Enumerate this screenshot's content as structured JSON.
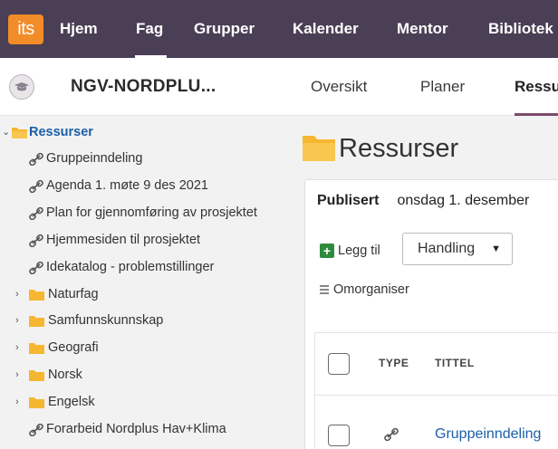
{
  "topnav": {
    "logo_text": "its",
    "items": [
      "Hjem",
      "Fag",
      "Grupper",
      "Kalender",
      "Mentor",
      "Bibliotek"
    ],
    "active": "Fag"
  },
  "subheader": {
    "course_title": "NGV-NORDPLU...",
    "tabs": [
      "Oversikt",
      "Planer",
      "Ressurser"
    ],
    "active_tab": "Ressurser"
  },
  "tree": {
    "root_label": "Ressurser",
    "items": [
      {
        "label": "Gruppeinndeling",
        "type": "link"
      },
      {
        "label": "Agenda 1. møte 9 des 2021",
        "type": "link"
      },
      {
        "label": "Plan for gjennomføring av prosjektet",
        "type": "link"
      },
      {
        "label": "Hjemmesiden til prosjektet",
        "type": "link"
      },
      {
        "label": "Idekatalog - problemstillinger",
        "type": "link"
      },
      {
        "label": "Naturfag",
        "type": "folder"
      },
      {
        "label": "Samfunnskunnskap",
        "type": "folder"
      },
      {
        "label": "Geografi",
        "type": "folder"
      },
      {
        "label": "Norsk",
        "type": "folder"
      },
      {
        "label": "Engelsk",
        "type": "folder"
      },
      {
        "label": "Forarbeid Nordplus Hav+Klima",
        "type": "link"
      }
    ]
  },
  "main": {
    "title": "Ressurser",
    "published_label": "Publisert",
    "published_date": "onsdag 1. desember",
    "add_label": "Legg til",
    "action_label": "Handling",
    "reorganize_label": "Omorganiser",
    "table": {
      "col_type": "TYPE",
      "col_title": "TITTEL",
      "rows": [
        {
          "title": "Gruppeinndeling"
        }
      ]
    }
  },
  "colors": {
    "nav_bg": "#4a3f55",
    "logo_bg": "#f28c28",
    "link_blue": "#1c5fa8",
    "folder_yellow": "#f5b731",
    "add_green": "#2e8b3d"
  }
}
